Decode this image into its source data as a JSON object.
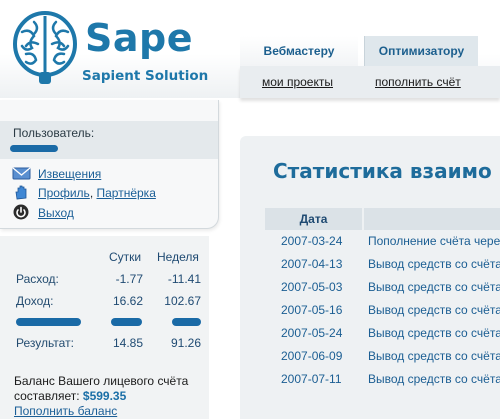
{
  "logo": {
    "title": "Sape",
    "subtitle": "Sapient Solution"
  },
  "tabs": [
    {
      "label": "Вебмастеру"
    },
    {
      "label": "Оптимизатору"
    }
  ],
  "subnav": [
    {
      "label": "мои проекты"
    },
    {
      "label": "пополнить счёт"
    }
  ],
  "user": {
    "label": "Пользователь:",
    "menu": {
      "notifications": "Извещения",
      "profile": "Профиль",
      "separator": ",",
      "partner": "Партнёрка",
      "logout": "Выход"
    }
  },
  "stats": {
    "col_day": "Сутки",
    "col_week": "Неделя",
    "rows": [
      {
        "label": "Расход:",
        "day": "-1.77",
        "week": "-11.41"
      },
      {
        "label": "Доход:",
        "day": "16.62",
        "week": "102.67"
      }
    ],
    "result": {
      "label": "Результат:",
      "day": "14.85",
      "week": "91.26"
    },
    "balance_text": "Баланс Вашего лицевого счёта составляет:",
    "balance_amount": "$599.35",
    "topup_link": "Пополнить баланс"
  },
  "main": {
    "title": "Статистика взаимо",
    "date_header": "Дата",
    "rows": [
      {
        "date": "2007-03-24",
        "desc": "Пополнение счёта чере"
      },
      {
        "date": "2007-04-13",
        "desc": "Вывод средств со счёта"
      },
      {
        "date": "2007-05-03",
        "desc": "Вывод средств со счёта"
      },
      {
        "date": "2007-05-16",
        "desc": "Вывод средств со счёта"
      },
      {
        "date": "2007-05-24",
        "desc": "Вывод средств со счёта"
      },
      {
        "date": "2007-06-09",
        "desc": "Вывод средств со счёта"
      },
      {
        "date": "2007-07-11",
        "desc": "Вывод средств со счёта"
      }
    ]
  },
  "colors": {
    "brand": "#1e78aa",
    "link": "#1b5f97",
    "panel": "#eef1f3"
  },
  "icons": {
    "logo": "brain-logo-icon",
    "notifications": "envelope-icon",
    "profile": "hand-icon",
    "logout": "power-icon"
  }
}
